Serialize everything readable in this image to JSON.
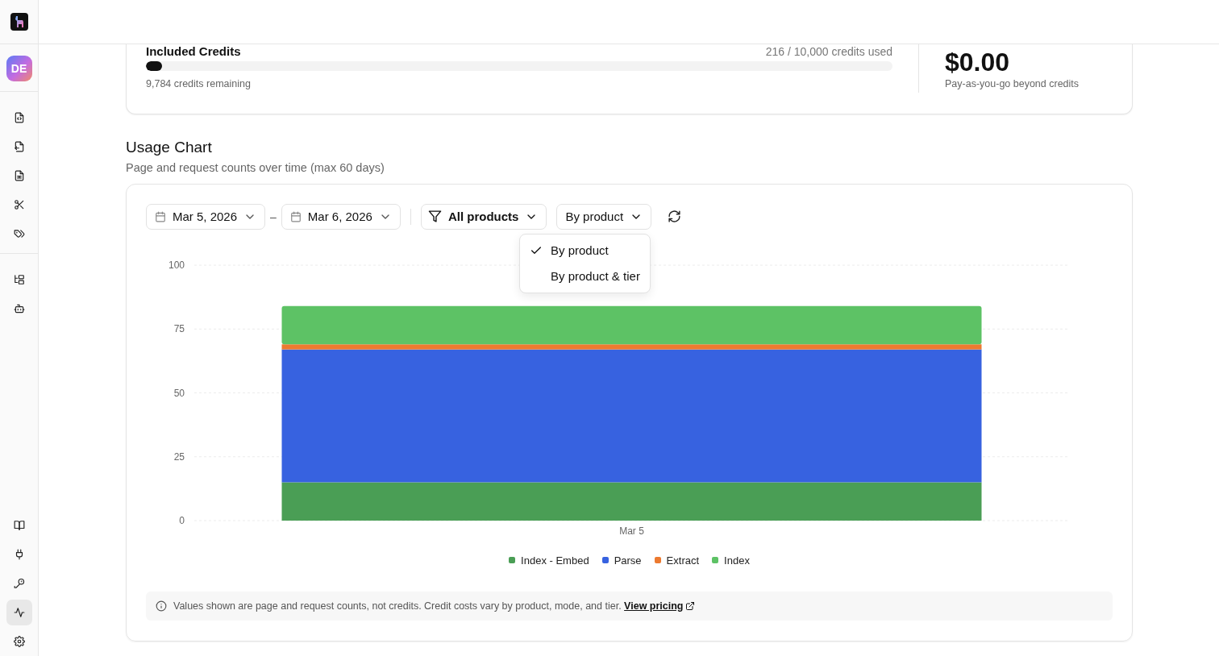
{
  "sidebar": {
    "avatar": "DE",
    "top_items": [
      {
        "selected": false
      },
      {
        "selected": false
      },
      {
        "selected": false
      },
      {
        "selected": false
      },
      {
        "selected": false
      }
    ],
    "middle_items": [
      {
        "selected": false
      },
      {
        "selected": false
      }
    ],
    "bottom_items": [
      {
        "selected": false
      },
      {
        "selected": false
      },
      {
        "selected": false
      },
      {
        "selected": true
      },
      {
        "selected": false
      }
    ]
  },
  "credits_card": {
    "title": "Included Credits",
    "usage": "216 / 10,000 credits used",
    "level": 0.022,
    "remaining": "9,784 credits remaining",
    "amount": "$0.00",
    "amount_note": "Pay-as-you-go beyond credits"
  },
  "usage_chart": {
    "title": "Usage Chart",
    "subtitle": "Page and request counts over time (max 60 days)",
    "start_date": "Mar 5, 2026",
    "separator": "–",
    "end_date": "Mar 6, 2026",
    "product_filter": "All products",
    "group_by": "By product",
    "group_menu": [
      {
        "label": "By product",
        "selected": true
      },
      {
        "label": "By product & tier",
        "selected": false
      }
    ],
    "chart_data": {
      "type": "bar",
      "stacked": true,
      "grid": true,
      "categories": [
        "Mar 5"
      ],
      "yticks": [
        0,
        25,
        50,
        75,
        100
      ],
      "ylim": [
        0,
        100
      ],
      "series": [
        {
          "name": "Index - Embed",
          "color": "#4a9e55",
          "values": [
            15
          ]
        },
        {
          "name": "Parse",
          "color": "#3762e0",
          "values": [
            52
          ]
        },
        {
          "name": "Extract",
          "color": "#ec7a30",
          "values": [
            2
          ]
        },
        {
          "name": "Index",
          "color": "#5dc265",
          "values": [
            15
          ]
        }
      ]
    },
    "notice": "Values shown are page and request counts, not credits. Credit costs vary by product, mode, and tier.",
    "notice_link": "View pricing"
  }
}
